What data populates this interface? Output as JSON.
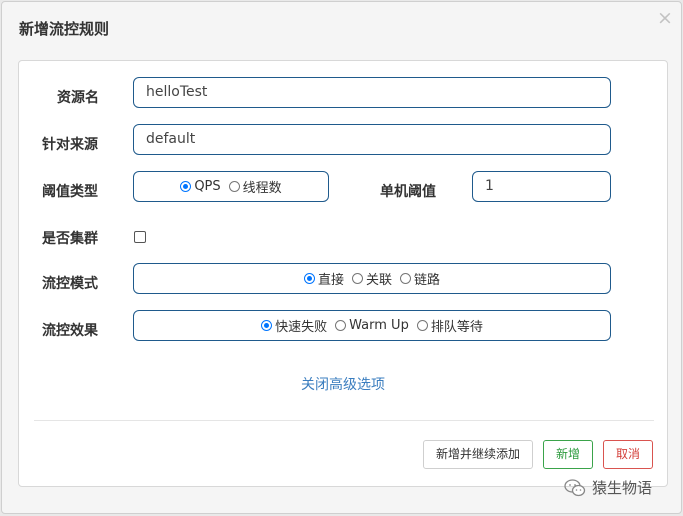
{
  "dialog": {
    "title": "新增流控规则",
    "close_glyph": "×"
  },
  "form": {
    "resource_name": {
      "label": "资源名",
      "value": "helloTest"
    },
    "limit_app": {
      "label": "针对来源",
      "value": "default"
    },
    "threshold_type": {
      "label": "阈值类型",
      "options": [
        "QPS",
        "线程数"
      ],
      "selected": "QPS"
    },
    "single_threshold": {
      "label": "单机阈值",
      "value": "1"
    },
    "cluster": {
      "label": "是否集群",
      "checked": false
    },
    "flow_mode": {
      "label": "流控模式",
      "options": [
        "直接",
        "关联",
        "链路"
      ],
      "selected": "直接"
    },
    "flow_effect": {
      "label": "流控效果",
      "options": [
        "快速失败",
        "Warm Up",
        "排队等待"
      ],
      "selected": "快速失败"
    },
    "advanced_link": "关闭高级选项"
  },
  "footer": {
    "add_continue": "新增并继续添加",
    "add": "新增",
    "cancel": "取消"
  },
  "watermark": {
    "text": "猿生物语",
    "icon": "wechat-icon"
  },
  "colors": {
    "input_border": "#1f5a8c",
    "link": "#3a7dbf",
    "success": "#3aa34a",
    "danger": "#d9534f",
    "radio_checked": "#0075ff"
  }
}
